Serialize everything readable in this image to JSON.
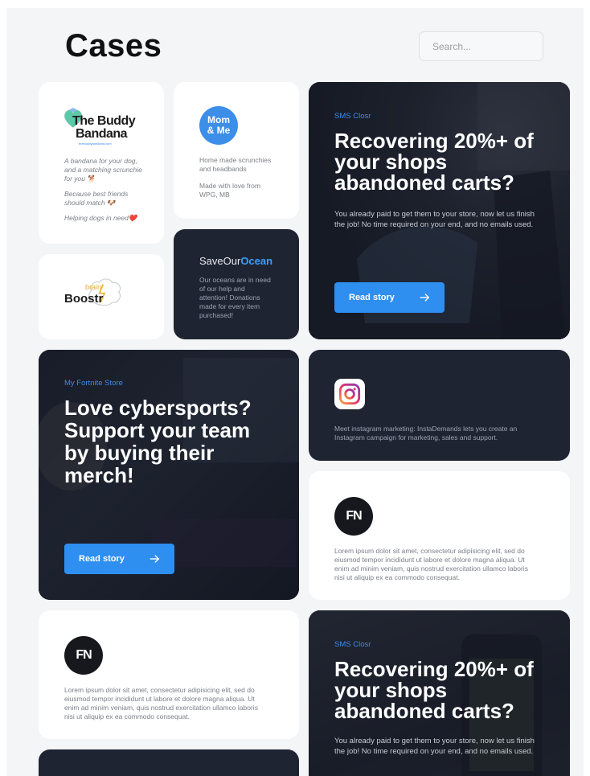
{
  "page": {
    "title": "Cases"
  },
  "search": {
    "placeholder": "Search..."
  },
  "cards": {
    "buddy": {
      "logo_line1": "The Buddy",
      "logo_line2": "Bandana",
      "logo_url": "thebuddybandana.com",
      "text1": "A bandana for your dog, and a matching scrunchie for you 🐕",
      "text2": "Because best friends should match 🐶",
      "text3": "Helping dogs in need❤️"
    },
    "mom": {
      "logo_line1": "Mom",
      "logo_line2": "& Me",
      "text1": "Home made scrunchies and headbands",
      "text2": "Made with love from WPG, MB"
    },
    "brain": {
      "logo_small": "brain",
      "logo_main": "Boostr"
    },
    "ocean": {
      "logo_prefix": "SaveOur",
      "logo_accent": "Ocean",
      "text": "Our oceans are in need of our help and attention! Donations made for every item purchased!"
    },
    "sms1": {
      "sub": "SMS Closr",
      "heading": "Recovering 20%+ of your shops abandoned carts?",
      "text": "You already paid to get them to your store, now let us finish the job! No time required on your end, and no emails used.",
      "button": "Read story"
    },
    "fortnite": {
      "sub": "My Fortnite Store",
      "heading": "Love cybersports? Support your team by buying their merch!",
      "button": "Read story"
    },
    "insta": {
      "text": "Meet instagram marketing: InstaDemands lets you create an Instagram campaign for marketing, sales and support."
    },
    "fn1": {
      "logo": "FN",
      "text": "Lorem ipsum dolor sit amet, consectetur adipisicing elit, sed do eiusmod tempor incididunt ut labore et dolore magna aliqua. Ut enim ad minim veniam, quis nostrud exercitation ullamco laboris nisi ut aliquip ex ea commodo consequat."
    },
    "fn2": {
      "logo": "FN",
      "text": "Lorem ipsum dolor sit amet, consectetur adipisicing elit, sed do eiusmod tempor incididunt ut labore et dolore magna aliqua. Ut enim ad minim veniam, quis nostrud exercitation ullamco laboris nisi ut aliquip ex ea commodo consequat."
    },
    "sms2": {
      "sub": "SMS Closr",
      "heading": "Recovering 20%+ of your shops abandoned carts?",
      "text": "You already paid to get them to your store, now let us finish the job! No time required on your end, and no emails used."
    }
  },
  "colors": {
    "accent": "#2e8ff0",
    "dark_card": "#1f2433",
    "ocean_accent": "#3aa0ff"
  }
}
